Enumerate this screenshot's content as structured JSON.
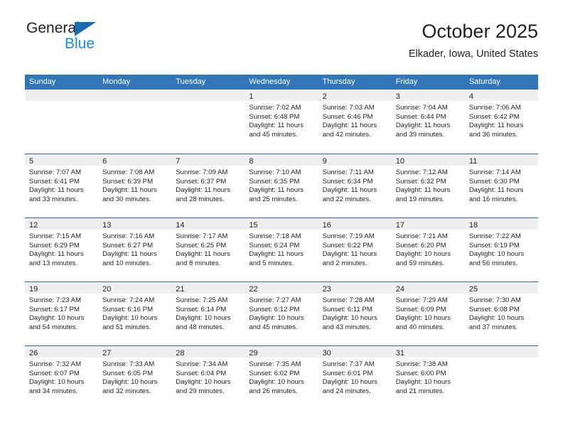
{
  "brand": {
    "name_primary": "General",
    "name_secondary": "Blue",
    "triangle_color": "#1b6cb5",
    "secondary_color": "#1b8fd4"
  },
  "header": {
    "title": "October 2025",
    "location": "Elkader, Iowa, United States"
  },
  "theme": {
    "header_blue": "#3176b8",
    "row_divider_blue": "#2e6da4",
    "day_band_gray": "#efefef",
    "text_color": "#231f20"
  },
  "weekdays": [
    "Sunday",
    "Monday",
    "Tuesday",
    "Wednesday",
    "Thursday",
    "Friday",
    "Saturday"
  ],
  "weeks": [
    [
      {
        "day": "",
        "sunrise": "",
        "sunset": "",
        "daylight_1": "",
        "daylight_2": "",
        "empty": true
      },
      {
        "day": "",
        "sunrise": "",
        "sunset": "",
        "daylight_1": "",
        "daylight_2": "",
        "empty": true
      },
      {
        "day": "",
        "sunrise": "",
        "sunset": "",
        "daylight_1": "",
        "daylight_2": "",
        "empty": true
      },
      {
        "day": "1",
        "sunrise": "Sunrise: 7:02 AM",
        "sunset": "Sunset: 6:48 PM",
        "daylight_1": "Daylight: 11 hours",
        "daylight_2": "and 45 minutes."
      },
      {
        "day": "2",
        "sunrise": "Sunrise: 7:03 AM",
        "sunset": "Sunset: 6:46 PM",
        "daylight_1": "Daylight: 11 hours",
        "daylight_2": "and 42 minutes."
      },
      {
        "day": "3",
        "sunrise": "Sunrise: 7:04 AM",
        "sunset": "Sunset: 6:44 PM",
        "daylight_1": "Daylight: 11 hours",
        "daylight_2": "and 39 minutes."
      },
      {
        "day": "4",
        "sunrise": "Sunrise: 7:06 AM",
        "sunset": "Sunset: 6:42 PM",
        "daylight_1": "Daylight: 11 hours",
        "daylight_2": "and 36 minutes."
      }
    ],
    [
      {
        "day": "5",
        "sunrise": "Sunrise: 7:07 AM",
        "sunset": "Sunset: 6:41 PM",
        "daylight_1": "Daylight: 11 hours",
        "daylight_2": "and 33 minutes."
      },
      {
        "day": "6",
        "sunrise": "Sunrise: 7:08 AM",
        "sunset": "Sunset: 6:39 PM",
        "daylight_1": "Daylight: 11 hours",
        "daylight_2": "and 30 minutes."
      },
      {
        "day": "7",
        "sunrise": "Sunrise: 7:09 AM",
        "sunset": "Sunset: 6:37 PM",
        "daylight_1": "Daylight: 11 hours",
        "daylight_2": "and 28 minutes."
      },
      {
        "day": "8",
        "sunrise": "Sunrise: 7:10 AM",
        "sunset": "Sunset: 6:35 PM",
        "daylight_1": "Daylight: 11 hours",
        "daylight_2": "and 25 minutes."
      },
      {
        "day": "9",
        "sunrise": "Sunrise: 7:11 AM",
        "sunset": "Sunset: 6:34 PM",
        "daylight_1": "Daylight: 11 hours",
        "daylight_2": "and 22 minutes."
      },
      {
        "day": "10",
        "sunrise": "Sunrise: 7:12 AM",
        "sunset": "Sunset: 6:32 PM",
        "daylight_1": "Daylight: 11 hours",
        "daylight_2": "and 19 minutes."
      },
      {
        "day": "11",
        "sunrise": "Sunrise: 7:14 AM",
        "sunset": "Sunset: 6:30 PM",
        "daylight_1": "Daylight: 11 hours",
        "daylight_2": "and 16 minutes."
      }
    ],
    [
      {
        "day": "12",
        "sunrise": "Sunrise: 7:15 AM",
        "sunset": "Sunset: 6:29 PM",
        "daylight_1": "Daylight: 11 hours",
        "daylight_2": "and 13 minutes."
      },
      {
        "day": "13",
        "sunrise": "Sunrise: 7:16 AM",
        "sunset": "Sunset: 6:27 PM",
        "daylight_1": "Daylight: 11 hours",
        "daylight_2": "and 10 minutes."
      },
      {
        "day": "14",
        "sunrise": "Sunrise: 7:17 AM",
        "sunset": "Sunset: 6:25 PM",
        "daylight_1": "Daylight: 11 hours",
        "daylight_2": "and 8 minutes."
      },
      {
        "day": "15",
        "sunrise": "Sunrise: 7:18 AM",
        "sunset": "Sunset: 6:24 PM",
        "daylight_1": "Daylight: 11 hours",
        "daylight_2": "and 5 minutes."
      },
      {
        "day": "16",
        "sunrise": "Sunrise: 7:19 AM",
        "sunset": "Sunset: 6:22 PM",
        "daylight_1": "Daylight: 11 hours",
        "daylight_2": "and 2 minutes."
      },
      {
        "day": "17",
        "sunrise": "Sunrise: 7:21 AM",
        "sunset": "Sunset: 6:20 PM",
        "daylight_1": "Daylight: 10 hours",
        "daylight_2": "and 59 minutes."
      },
      {
        "day": "18",
        "sunrise": "Sunrise: 7:22 AM",
        "sunset": "Sunset: 6:19 PM",
        "daylight_1": "Daylight: 10 hours",
        "daylight_2": "and 56 minutes."
      }
    ],
    [
      {
        "day": "19",
        "sunrise": "Sunrise: 7:23 AM",
        "sunset": "Sunset: 6:17 PM",
        "daylight_1": "Daylight: 10 hours",
        "daylight_2": "and 54 minutes."
      },
      {
        "day": "20",
        "sunrise": "Sunrise: 7:24 AM",
        "sunset": "Sunset: 6:16 PM",
        "daylight_1": "Daylight: 10 hours",
        "daylight_2": "and 51 minutes."
      },
      {
        "day": "21",
        "sunrise": "Sunrise: 7:25 AM",
        "sunset": "Sunset: 6:14 PM",
        "daylight_1": "Daylight: 10 hours",
        "daylight_2": "and 48 minutes."
      },
      {
        "day": "22",
        "sunrise": "Sunrise: 7:27 AM",
        "sunset": "Sunset: 6:12 PM",
        "daylight_1": "Daylight: 10 hours",
        "daylight_2": "and 45 minutes."
      },
      {
        "day": "23",
        "sunrise": "Sunrise: 7:28 AM",
        "sunset": "Sunset: 6:11 PM",
        "daylight_1": "Daylight: 10 hours",
        "daylight_2": "and 43 minutes."
      },
      {
        "day": "24",
        "sunrise": "Sunrise: 7:29 AM",
        "sunset": "Sunset: 6:09 PM",
        "daylight_1": "Daylight: 10 hours",
        "daylight_2": "and 40 minutes."
      },
      {
        "day": "25",
        "sunrise": "Sunrise: 7:30 AM",
        "sunset": "Sunset: 6:08 PM",
        "daylight_1": "Daylight: 10 hours",
        "daylight_2": "and 37 minutes."
      }
    ],
    [
      {
        "day": "26",
        "sunrise": "Sunrise: 7:32 AM",
        "sunset": "Sunset: 6:07 PM",
        "daylight_1": "Daylight: 10 hours",
        "daylight_2": "and 34 minutes."
      },
      {
        "day": "27",
        "sunrise": "Sunrise: 7:33 AM",
        "sunset": "Sunset: 6:05 PM",
        "daylight_1": "Daylight: 10 hours",
        "daylight_2": "and 32 minutes."
      },
      {
        "day": "28",
        "sunrise": "Sunrise: 7:34 AM",
        "sunset": "Sunset: 6:04 PM",
        "daylight_1": "Daylight: 10 hours",
        "daylight_2": "and 29 minutes."
      },
      {
        "day": "29",
        "sunrise": "Sunrise: 7:35 AM",
        "sunset": "Sunset: 6:02 PM",
        "daylight_1": "Daylight: 10 hours",
        "daylight_2": "and 26 minutes."
      },
      {
        "day": "30",
        "sunrise": "Sunrise: 7:37 AM",
        "sunset": "Sunset: 6:01 PM",
        "daylight_1": "Daylight: 10 hours",
        "daylight_2": "and 24 minutes."
      },
      {
        "day": "31",
        "sunrise": "Sunrise: 7:38 AM",
        "sunset": "Sunset: 6:00 PM",
        "daylight_1": "Daylight: 10 hours",
        "daylight_2": "and 21 minutes."
      },
      {
        "day": "",
        "sunrise": "",
        "sunset": "",
        "daylight_1": "",
        "daylight_2": "",
        "empty": true
      }
    ]
  ]
}
